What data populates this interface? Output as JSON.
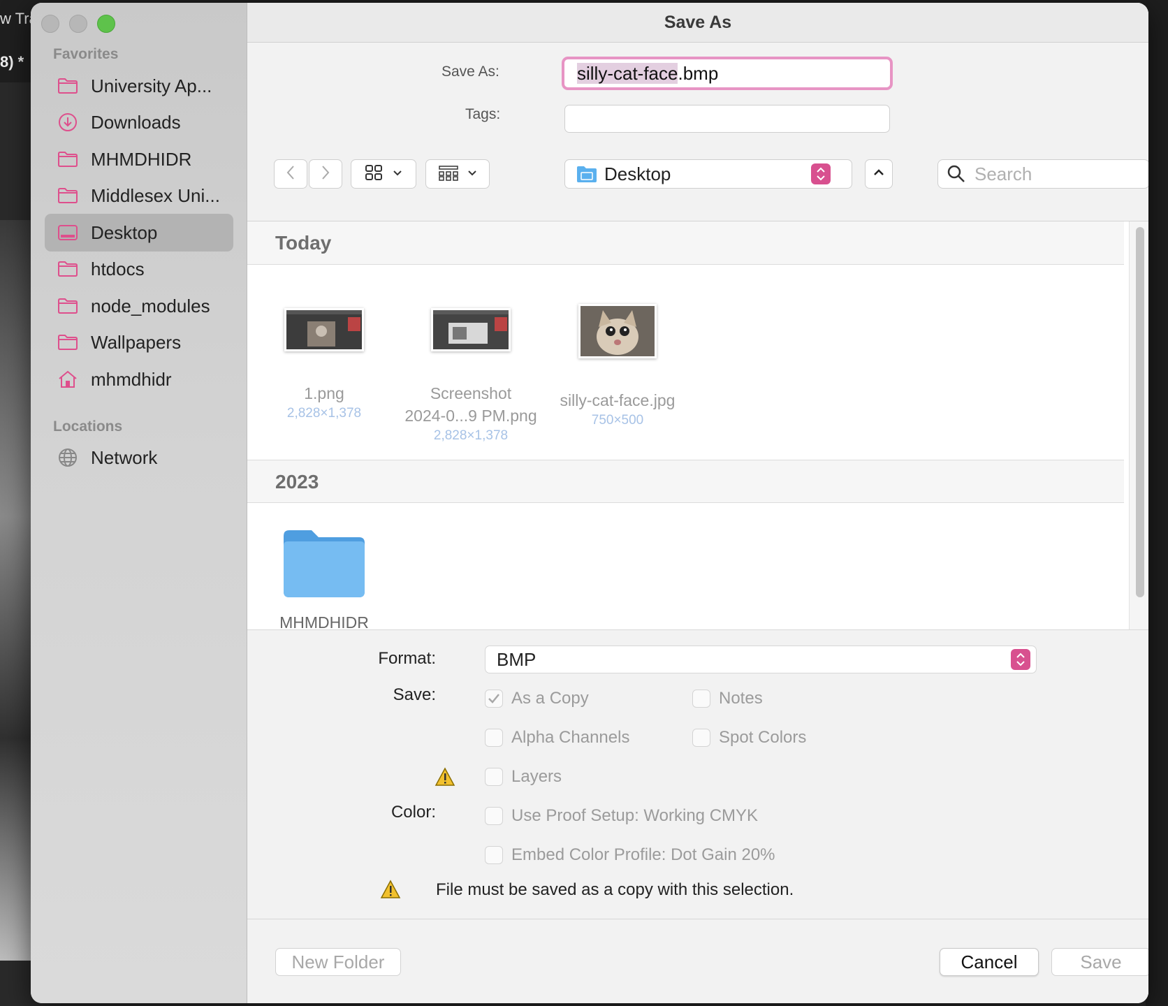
{
  "background_app": {
    "tab_text": "w Tra",
    "doc_text": "8) *"
  },
  "window": {
    "title": "Save As"
  },
  "sidebar": {
    "favorites_heading": "Favorites",
    "items": [
      {
        "label": "University Ap...",
        "icon": "folder-icon"
      },
      {
        "label": "Downloads",
        "icon": "download-icon"
      },
      {
        "label": "MHMDHIDR",
        "icon": "folder-icon"
      },
      {
        "label": "Middlesex Uni...",
        "icon": "folder-icon"
      },
      {
        "label": "Desktop",
        "icon": "desktop-icon",
        "selected": true
      },
      {
        "label": "htdocs",
        "icon": "folder-icon"
      },
      {
        "label": "node_modules",
        "icon": "folder-icon"
      },
      {
        "label": "Wallpapers",
        "icon": "folder-icon"
      },
      {
        "label": "mhmdhidr",
        "icon": "home-icon"
      }
    ],
    "locations_heading": "Locations",
    "locations": [
      {
        "label": "Network",
        "icon": "globe-icon"
      }
    ]
  },
  "form": {
    "save_as_label": "Save As:",
    "filename_selected": "silly-cat-face",
    "filename_ext": ".bmp",
    "tags_label": "Tags:",
    "tags_value": "",
    "location": "Desktop",
    "search_placeholder": "Search"
  },
  "browser": {
    "sections": [
      {
        "title": "Today",
        "files": [
          {
            "name_line1": "1.png",
            "name_line2": "",
            "dims": "2,828×1,378"
          },
          {
            "name_line1": "Screenshot",
            "name_line2": "2024-0...9 PM.png",
            "dims": "2,828×1,378"
          },
          {
            "name_line1": "silly-cat-face.jpg",
            "name_line2": "",
            "dims": "750×500"
          }
        ]
      },
      {
        "title": "2023",
        "files": [
          {
            "name_line1": "MHMDHIDR"
          }
        ]
      }
    ]
  },
  "options": {
    "format_label": "Format:",
    "format_value": "BMP",
    "save_label": "Save:",
    "color_label": "Color:",
    "checkboxes": {
      "as_a_copy": {
        "label": "As a Copy",
        "checked": true
      },
      "notes": {
        "label": "Notes",
        "checked": false
      },
      "alpha_channels": {
        "label": "Alpha Channels",
        "checked": false
      },
      "spot_colors": {
        "label": "Spot Colors",
        "checked": false
      },
      "layers": {
        "label": "Layers",
        "checked": false
      },
      "use_proof_setup": {
        "label": "Use Proof Setup:  Working CMYK",
        "checked": false
      },
      "embed_color_profile": {
        "label": "Embed Color Profile:  Dot Gain 20%",
        "checked": false
      }
    },
    "warning_text": "File must be saved as a copy with this selection."
  },
  "footer": {
    "new_folder": "New Folder",
    "cancel": "Cancel",
    "save": "Save"
  },
  "colors": {
    "accent": "#d8508f",
    "focus_ring": "#e794c4",
    "sidebar_icon": "#de4f8c",
    "folder_blue": "#6cb5ef"
  }
}
